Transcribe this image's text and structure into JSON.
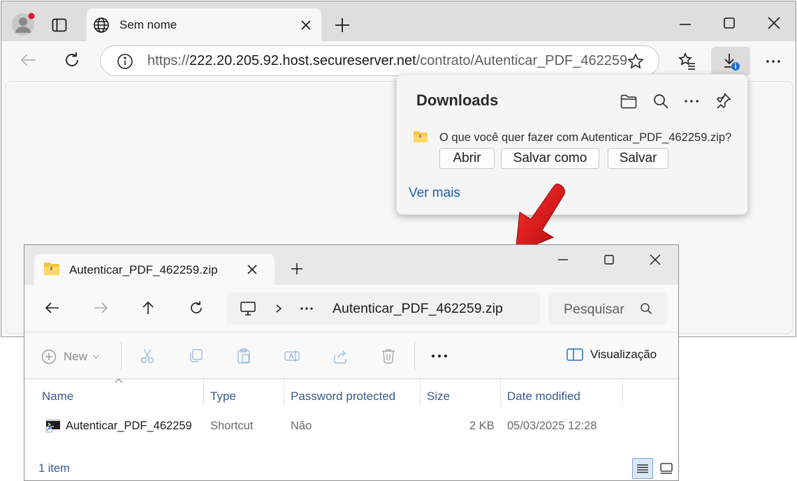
{
  "browser": {
    "tab_title": "Sem nome",
    "url_scheme": "https://",
    "url_host": "222.20.205.92.host.secureserver.net",
    "url_path": "/contrato/Autenticar_PDF_462259"
  },
  "downloads": {
    "title": "Downloads",
    "question": "O que você quer fazer com Autenticar_PDF_462259.zip?",
    "buttons": [
      "Abrir",
      "Salvar como",
      "Salvar"
    ],
    "see_more": "Ver mais"
  },
  "explorer": {
    "tab_title": "Autenticar_PDF_462259.zip",
    "path": "Autenticar_PDF_462259.zip",
    "search_placeholder": "Pesquisar",
    "new_label": "New",
    "view_label": "Visualização",
    "columns": [
      "Name",
      "Type",
      "Password protected",
      "Size",
      "Date modified"
    ],
    "rows": [
      {
        "name": "Autenticar_PDF_462259",
        "type": "Shortcut",
        "password_protected": "Não",
        "size": "2 KB",
        "date_modified": "05/03/2025 12:28"
      }
    ],
    "status": "1 item"
  },
  "colors": {
    "annotation_arrow": "#d40000",
    "link": "#1a5fb4",
    "notification_dot": "#e0182d",
    "download_badge": "#1f6fd1"
  }
}
